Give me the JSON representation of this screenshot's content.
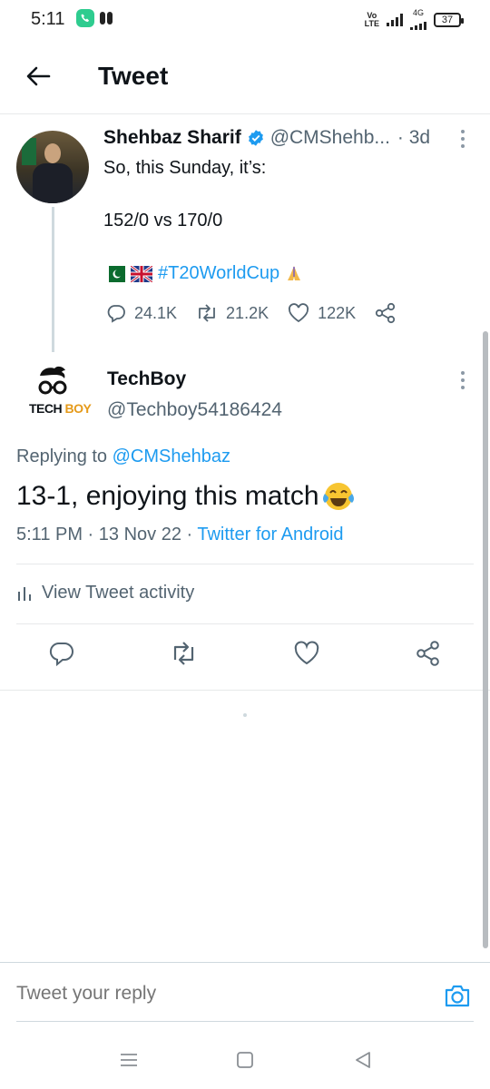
{
  "status_bar": {
    "time": "5:11",
    "volte_top": "Vo",
    "volte_bottom": "LTE",
    "network": "4G",
    "battery": "37"
  },
  "header": {
    "title": "Tweet",
    "back_icon": "back-arrow-icon"
  },
  "original_tweet": {
    "name": "Shehbaz Sharif",
    "handle": "@CMShehb...",
    "time": "· 3d",
    "line1": "So, this Sunday, it’s:",
    "line2": "152/0 vs 170/0",
    "hashtag": "#T20WorldCup",
    "replies": "24.1K",
    "retweets": "21.2K",
    "likes": "122K"
  },
  "reply_tweet": {
    "logo_text_1": "TECH",
    "logo_text_2": "BOY",
    "name": "TechBoy",
    "handle": "@Techboy54186424",
    "replying_prefix": "Replying to",
    "replying_handle": "@CMShehbaz",
    "text": "13-1, enjoying this match",
    "meta_time": "5:11 PM · 13 Nov 22 · ",
    "meta_app": "Twitter for Android",
    "activity_label": "View Tweet activity"
  },
  "reply_bar": {
    "placeholder": "Tweet your reply"
  },
  "colors": {
    "accent": "#1d9bf0",
    "text": "#0f1419",
    "secondary": "#536471"
  }
}
